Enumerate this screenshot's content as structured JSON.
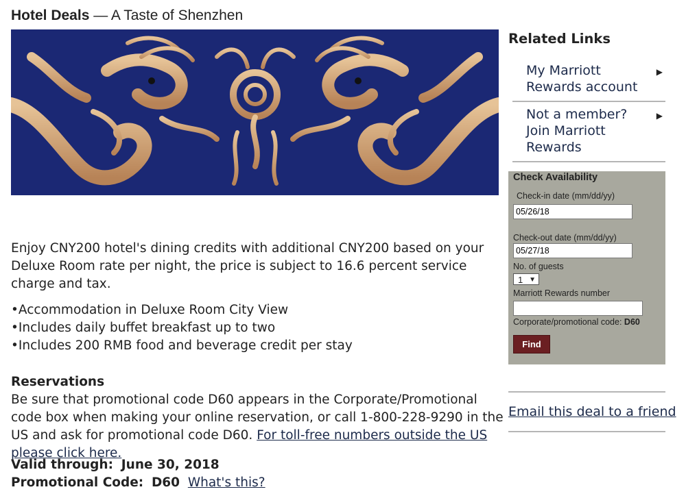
{
  "header": {
    "title_bold": "Hotel Deals",
    "title_rest": " — A Taste of Shenzhen"
  },
  "banner": {
    "icon": "dragon-banner-image"
  },
  "offer": {
    "description": "Enjoy CNY200 hotel's dining credits with additional CNY200 based on your Deluxe Room rate per night, the price is subject to 16.6 percent service charge and tax.",
    "bullets": [
      "Accommodation in Deluxe Room City View",
      "Includes daily buffet breakfast up to two",
      "Includes 200 RMB food and beverage credit per stay"
    ]
  },
  "reservations": {
    "heading": "Reservations",
    "text": "Be sure that promotional code D60 appears in the Corporate/Promotional code box when making your online reservation, or call 1-800-228-9290 in the US and ask for promotional code D60. ",
    "link": "For toll-free numbers outside the US please click here."
  },
  "validity": {
    "valid_label": "Valid through:",
    "valid_value": "June 30, 2018",
    "promo_label": "Promotional Code:",
    "promo_value": "D60",
    "whats_this": "What's this?"
  },
  "related_links": {
    "title": "Related Links",
    "items": [
      {
        "label": "My Marriott Rewards account",
        "icon": "arrow-right-icon"
      },
      {
        "label": "Not a member? Join Marriott Rewards",
        "icon": "arrow-right-icon"
      }
    ]
  },
  "availability": {
    "title": "Check Availability",
    "checkin_label": "Check-in date (mm/dd/yy)",
    "checkin_value": "05/26/18",
    "checkout_label": "Check-out date (mm/dd/yy)",
    "checkout_value": "05/27/18",
    "guests_label": "No. of guests",
    "guests_value": "1",
    "rewards_label": "Marriott Rewards number",
    "rewards_value": "",
    "corp_label": "Corporate/promotional code:",
    "corp_value": "D60",
    "find_label": "Find",
    "find_color": "#6b1f22",
    "panel_color": "#a8a89e"
  },
  "email_link": "Email this deal to a friend"
}
